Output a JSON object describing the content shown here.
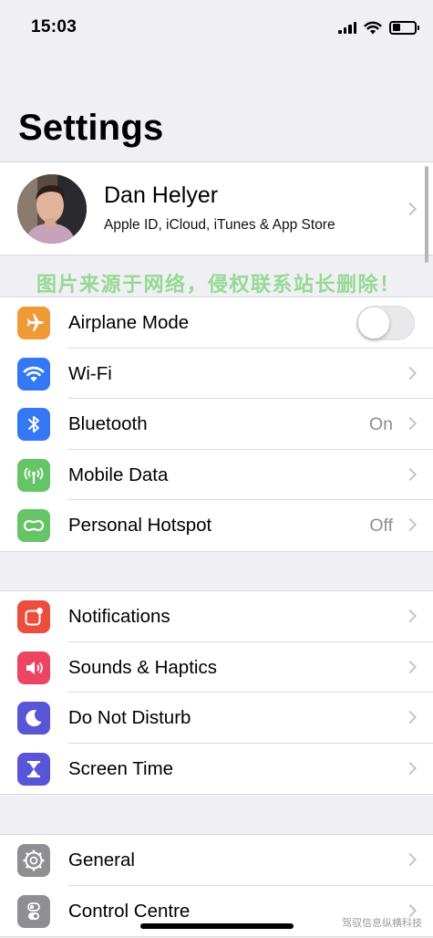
{
  "status_bar": {
    "time": "15:03",
    "battery_level": 0.35,
    "icons": [
      "cellular-signal-icon",
      "wifi-icon",
      "battery-icon"
    ]
  },
  "header": {
    "title": "Settings"
  },
  "profile": {
    "name": "Dan Helyer",
    "subtitle": "Apple ID, iCloud, iTunes & App Store"
  },
  "watermark": "图片来源于网络，侵权联系站长删除！",
  "groups": [
    {
      "rows": [
        {
          "label": "Airplane Mode",
          "icon": "airplane-icon",
          "color": "#f09a37",
          "toggle": false
        },
        {
          "label": "Wi-Fi",
          "icon": "wifi-icon",
          "color": "#3478f6",
          "value": ""
        },
        {
          "label": "Bluetooth",
          "icon": "bluetooth-icon",
          "color": "#3478f6",
          "value": "On"
        },
        {
          "label": "Mobile Data",
          "icon": "antenna-icon",
          "color": "#65c466",
          "value": ""
        },
        {
          "label": "Personal Hotspot",
          "icon": "chain-link-icon",
          "color": "#65c466",
          "value": "Off"
        }
      ]
    },
    {
      "rows": [
        {
          "label": "Notifications",
          "icon": "notifications-icon",
          "color": "#eb4e3d"
        },
        {
          "label": "Sounds & Haptics",
          "icon": "speaker-icon",
          "color": "#eb4562"
        },
        {
          "label": "Do Not Disturb",
          "icon": "moon-icon",
          "color": "#5856d6"
        },
        {
          "label": "Screen Time",
          "icon": "hourglass-icon",
          "color": "#5856d6"
        }
      ]
    },
    {
      "rows": [
        {
          "label": "General",
          "icon": "gear-icon",
          "color": "#8e8e93"
        },
        {
          "label": "Control Centre",
          "icon": "toggles-icon",
          "color": "#8e8e93"
        }
      ]
    }
  ],
  "credit": "驾驭信息纵横科技"
}
